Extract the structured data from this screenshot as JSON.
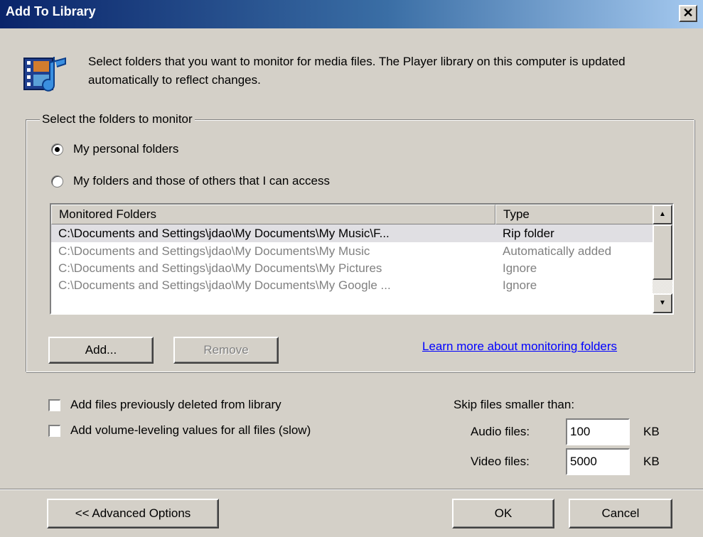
{
  "window": {
    "title": "Add To Library",
    "close_glyph": "✕"
  },
  "intro_text": "Select folders that you want to monitor for media files. The Player library on this computer is updated automatically to reflect changes.",
  "monitor_group": {
    "legend": "Select the folders to monitor",
    "radio_personal": "My personal folders",
    "radio_others": "My folders and those of others that I can access",
    "selected": "personal"
  },
  "folder_list": {
    "columns": [
      "Monitored Folders",
      "Type"
    ],
    "rows": [
      {
        "path": "C:\\Documents and Settings\\jdao\\My Documents\\My Music\\F...",
        "type": "Rip folder"
      },
      {
        "path": "C:\\Documents and Settings\\jdao\\My Documents\\My Music",
        "type": "Automatically added"
      },
      {
        "path": "C:\\Documents and Settings\\jdao\\My Documents\\My Pictures",
        "type": "Ignore"
      },
      {
        "path": "C:\\Documents and Settings\\jdao\\My Documents\\My Google ...",
        "type": "Ignore"
      }
    ]
  },
  "buttons": {
    "add": "Add...",
    "remove": "Remove",
    "advanced": "<< Advanced Options",
    "ok": "OK",
    "cancel": "Cancel"
  },
  "link_text": "Learn more about monitoring folders",
  "options": {
    "add_deleted": "Add files previously deleted from library",
    "add_volume": "Add volume-leveling values for all files (slow)"
  },
  "skip": {
    "heading": "Skip files smaller than:",
    "audio_label": "Audio files:",
    "audio_value": "100",
    "video_label": "Video files:",
    "video_value": "5000",
    "unit": "KB"
  },
  "icons": {
    "media": "media-library-icon",
    "scroll_up": "scroll-up-icon",
    "scroll_down": "scroll-down-icon"
  }
}
